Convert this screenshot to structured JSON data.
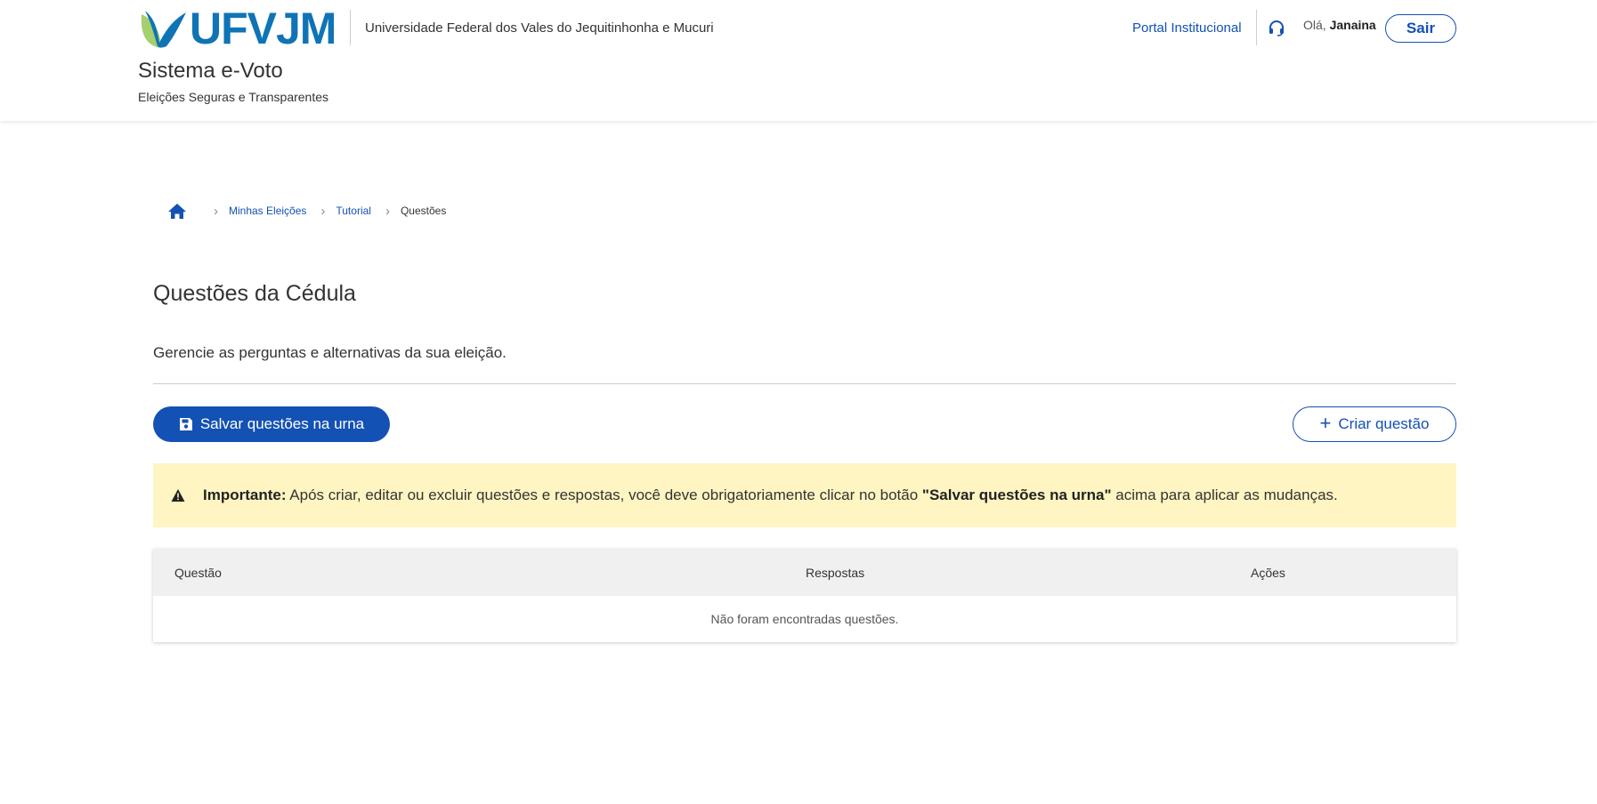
{
  "header": {
    "logo_text": "UFVJM",
    "university_name": "Universidade Federal dos Vales do Jequitinhonha e Mucuri",
    "system_title": "Sistema e-Voto",
    "system_subtitle": "Eleições Seguras e Transparentes",
    "portal_link": "Portal Institucional",
    "greeting_prefix": "Olá,",
    "user_name": "Janaina",
    "logout_label": "Sair"
  },
  "breadcrumb": {
    "items": [
      "Minhas Eleições",
      "Tutorial"
    ],
    "current": "Questões"
  },
  "main": {
    "title": "Questões da Cédula",
    "description": "Gerencie as perguntas e alternativas da sua eleição.",
    "save_button": "Salvar questões na urna",
    "create_button": "Criar questão",
    "alert": {
      "strong": "Importante:",
      "text_before": " Após criar, editar ou excluir questões e respostas, você deve obrigatoriamente clicar no botão ",
      "strong_quote": "\"Salvar questões na urna\"",
      "text_after": " acima para aplicar as mudanças."
    },
    "table": {
      "columns": [
        "Questão",
        "Respostas",
        "Ações"
      ],
      "empty_message": "Não foram encontradas questões."
    }
  },
  "colors": {
    "primary": "#1351b4",
    "logo_blue": "#0f74b6",
    "logo_green": "#a6cf6e",
    "alert_bg": "#fff5c2"
  },
  "icons": [
    "home-icon",
    "chevron-right-icon",
    "headset-icon",
    "save-icon",
    "plus-icon",
    "warning-icon"
  ]
}
